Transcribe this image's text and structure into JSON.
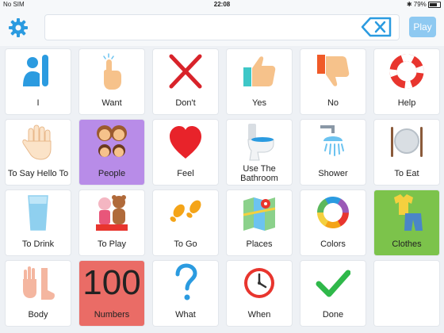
{
  "status": {
    "carrier": "No SIM",
    "time": "22:08",
    "battery": "79%",
    "battery_level": 0.79
  },
  "toolbar": {
    "play_label": "Play"
  },
  "colors": {
    "purple": "#b88ce8",
    "green": "#7cc34b",
    "red": "#ea6c66",
    "accent": "#2b9be0"
  },
  "tiles": [
    {
      "label": "I",
      "icon": "raised-hand-person-icon"
    },
    {
      "label": "Want",
      "icon": "pointing-hand-icon"
    },
    {
      "label": "Don't",
      "icon": "red-x-icon"
    },
    {
      "label": "Yes",
      "icon": "thumbs-up-icon"
    },
    {
      "label": "No",
      "icon": "thumbs-down-icon"
    },
    {
      "label": "Help",
      "icon": "life-ring-icon"
    },
    {
      "label": "To Say Hello To",
      "icon": "waving-hand-icon"
    },
    {
      "label": "People",
      "icon": "family-faces-icon"
    },
    {
      "label": "Feel",
      "icon": "heart-icon"
    },
    {
      "label": "Use The Bathroom",
      "icon": "toilet-icon"
    },
    {
      "label": "Shower",
      "icon": "shower-icon"
    },
    {
      "label": "To Eat",
      "icon": "plate-utensils-icon"
    },
    {
      "label": "To Drink",
      "icon": "glass-icon"
    },
    {
      "label": "To Play",
      "icon": "toys-icon"
    },
    {
      "label": "To Go",
      "icon": "footprints-icon"
    },
    {
      "label": "Places",
      "icon": "map-icon"
    },
    {
      "label": "Colors",
      "icon": "color-wheel-icon"
    },
    {
      "label": "Clothes",
      "icon": "clothes-icon"
    },
    {
      "label": "Body",
      "icon": "hand-foot-icon"
    },
    {
      "label": "Numbers",
      "icon": "number-100",
      "number": "100"
    },
    {
      "label": "What",
      "icon": "question-mark-icon"
    },
    {
      "label": "When",
      "icon": "clock-icon"
    },
    {
      "label": "Done",
      "icon": "checkmark-icon"
    },
    {
      "label": "",
      "icon": ""
    }
  ]
}
